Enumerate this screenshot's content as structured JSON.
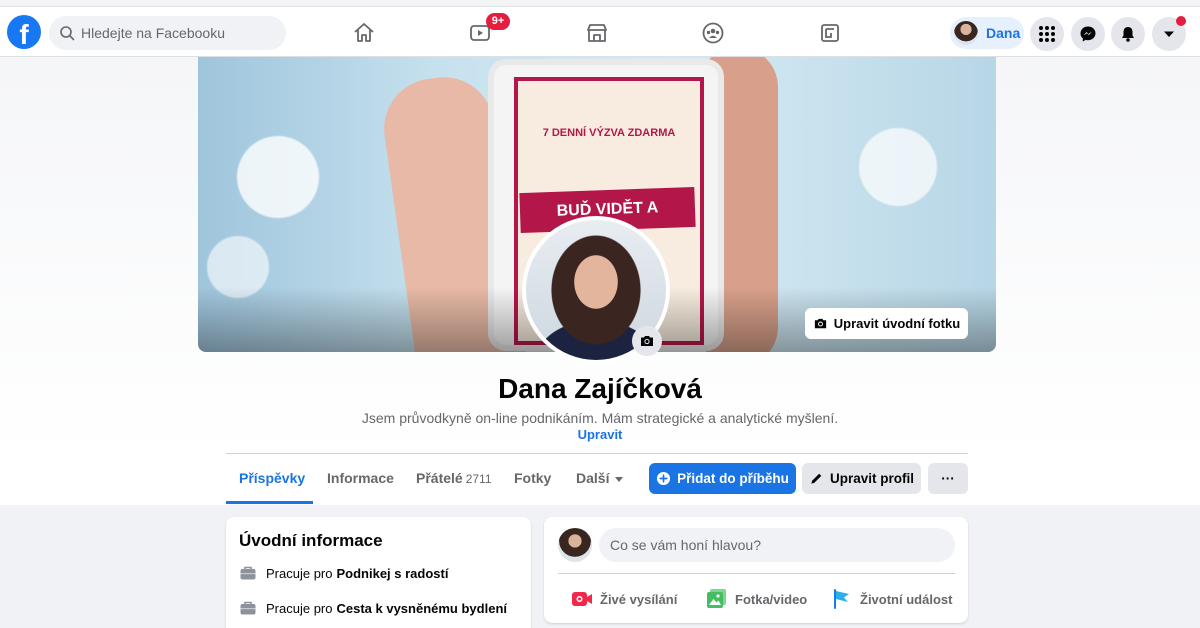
{
  "topbar": {
    "logo_letter": "f",
    "search_placeholder": "Hledejte na Facebooku",
    "video_badge": "9+",
    "profile_name": "Dana",
    "icons": [
      "home-icon",
      "watch-icon",
      "marketplace-icon",
      "groups-icon",
      "gaming-icon",
      "menu-grid-icon",
      "messenger-icon",
      "bell-icon",
      "chevron-down-icon"
    ],
    "accent_color": "#1877f2",
    "badge_color": "#e41e3f"
  },
  "cover": {
    "edit_label": "Upravit úvodní fotku",
    "headline_small": "7 DENNÍ VÝZVA ZDARMA",
    "headline_banner": "BUĎ VIDĚT A PRODÁVEJ"
  },
  "profile": {
    "name": "Dana Zajíčková",
    "bio": "Jsem průvodkyně on-line podnikáním. Mám strategické a analytické myšlení.",
    "bio_edit_label": "Upravit"
  },
  "tabs": [
    {
      "label": "Příspěvky",
      "active": true
    },
    {
      "label": "Informace"
    },
    {
      "label": "Přátelé",
      "count": "2711"
    },
    {
      "label": "Fotky"
    },
    {
      "label": "Další"
    }
  ],
  "actions": {
    "add_story": "Přidat do příběhu",
    "edit_profile": "Upravit profil",
    "more": "···"
  },
  "intro": {
    "title": "Úvodní informace",
    "items": [
      {
        "prefix": "Pracuje pro",
        "place": "Podnikej s radostí"
      },
      {
        "prefix": "Pracuje pro",
        "place": "Cesta k vysněnému bydlení"
      }
    ]
  },
  "composer": {
    "placeholder": "Co se vám honí hlavou?",
    "actions": [
      {
        "label": "Živé vysílání",
        "color": "#f02849"
      },
      {
        "label": "Fotka/video",
        "color": "#45bd62"
      },
      {
        "label": "Životní událost",
        "color": "#1877f2"
      }
    ]
  }
}
